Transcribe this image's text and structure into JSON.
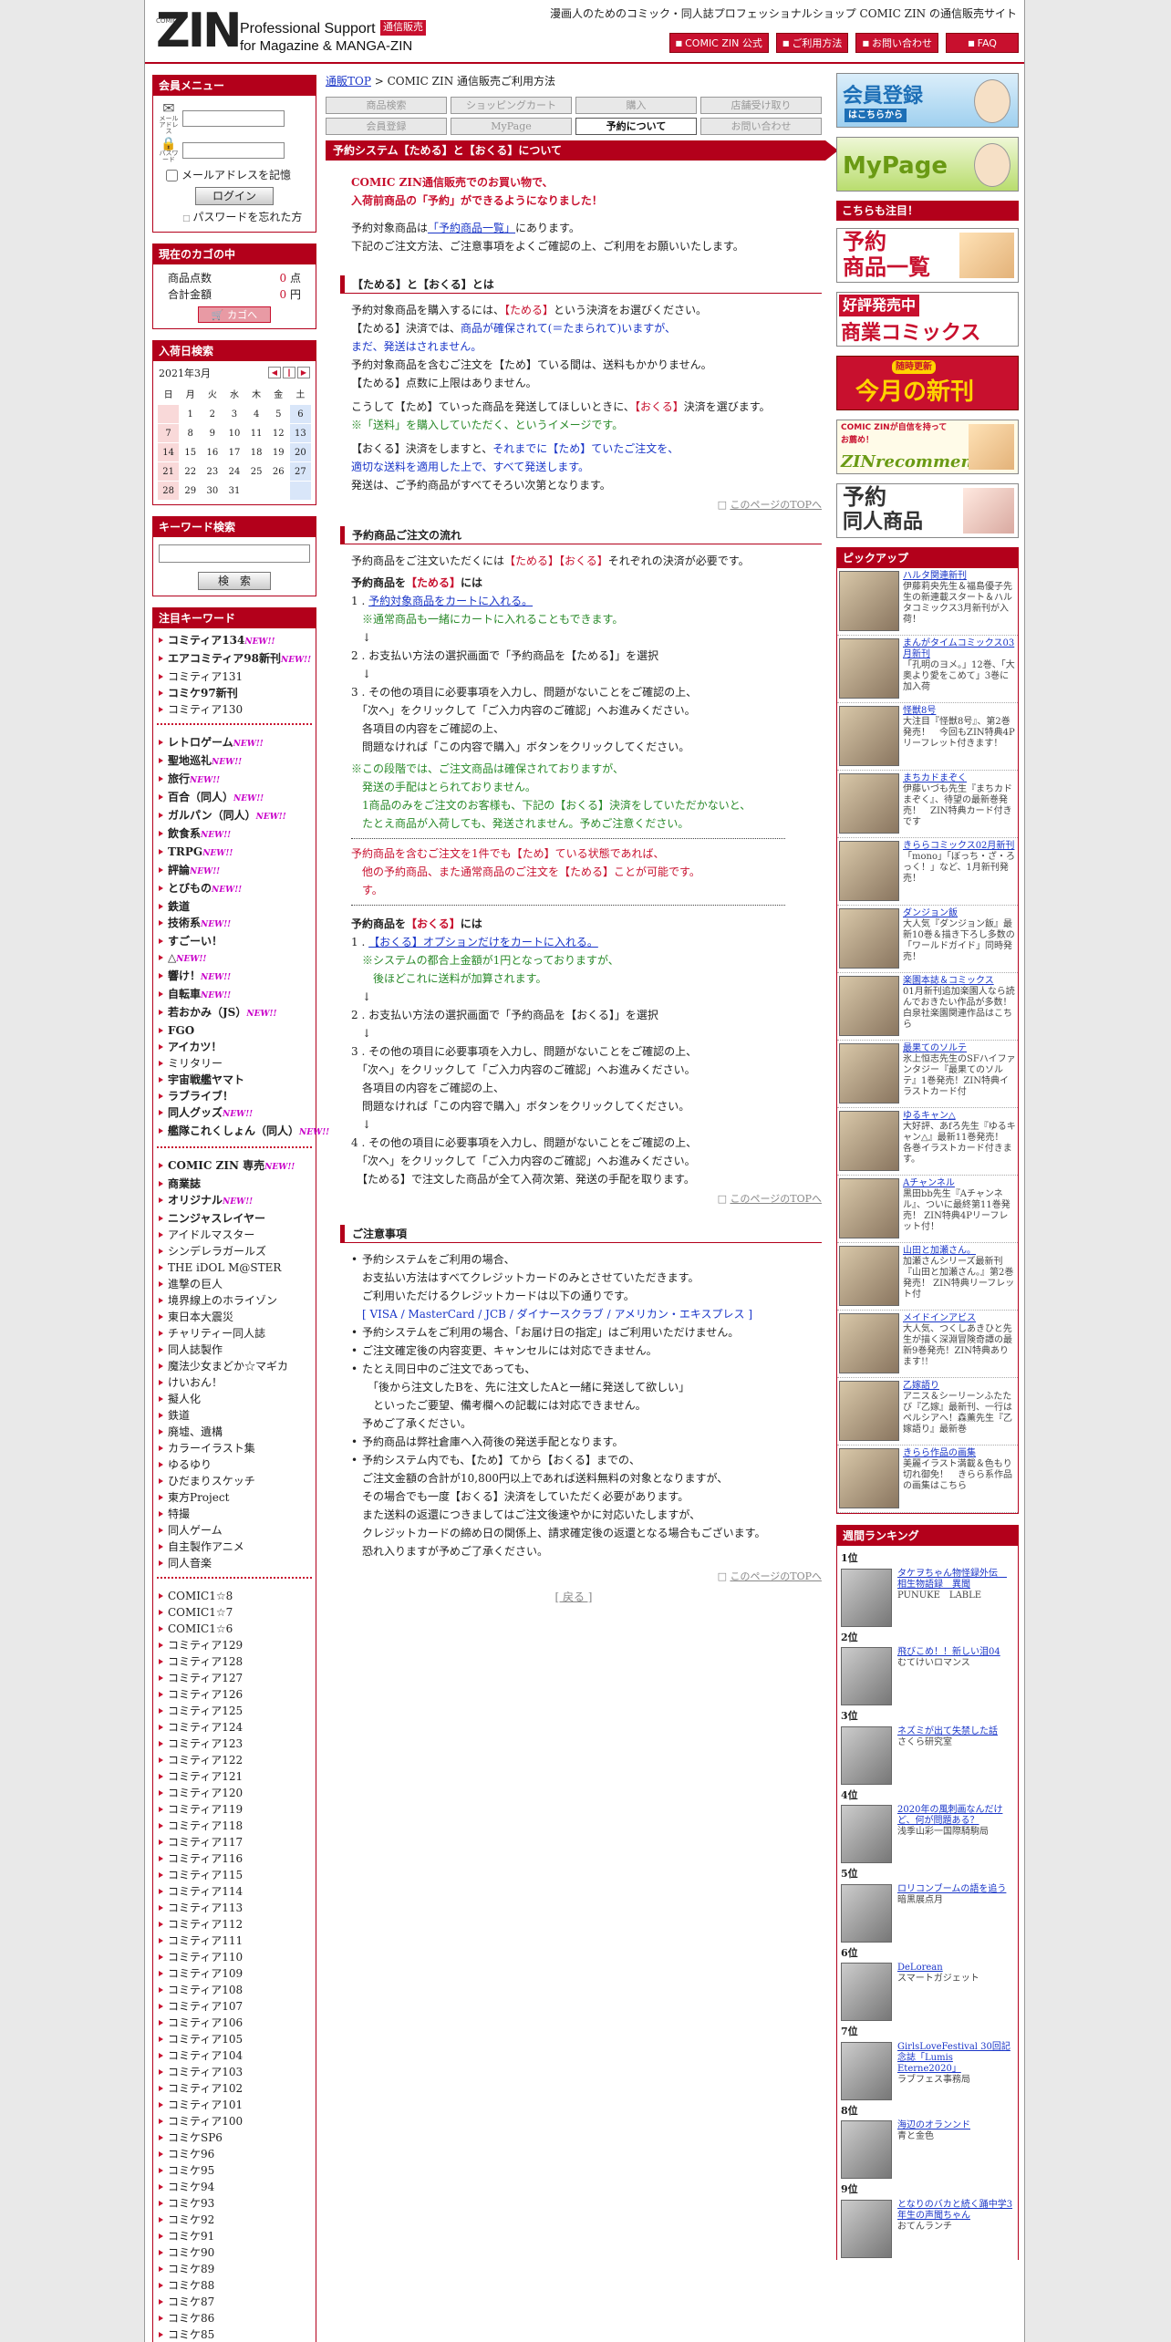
{
  "header": {
    "logo_small": "COMIC",
    "logo": "ZIN",
    "line1": "Professional Support",
    "badge": "通信販売",
    "line2": "for Magazine & MANGA-ZIN",
    "tagline": "漫画人のためのコミック・同人誌プロフェッショナルショップ COMIC ZIN の通信販売サイト",
    "buttons": [
      "COMIC ZIN 公式",
      "ご利用方法",
      "お問い合わせ",
      "FAQ"
    ]
  },
  "login": {
    "title": "会員メニュー",
    "mail_label": "メールアドレス",
    "pass_label": "パスワード",
    "remember": "メールアドレスを記憶",
    "login_button": "ログイン",
    "forgot": "パスワードを忘れた方"
  },
  "cart": {
    "title": "現在のカゴの中",
    "count_label": "商品点数",
    "count_value": "0",
    "count_unit": "点",
    "total_label": "合計金額",
    "total_value": "0",
    "total_unit": "円",
    "button": "カゴへ"
  },
  "calendar": {
    "title": "入荷日検索",
    "month": "2021年3月",
    "weekdays": [
      "日",
      "月",
      "火",
      "水",
      "木",
      "金",
      "土"
    ],
    "weeks": [
      [
        "",
        "1",
        "2",
        "3",
        "4",
        "5",
        "6"
      ],
      [
        "7",
        "8",
        "9",
        "10",
        "11",
        "12",
        "13"
      ],
      [
        "14",
        "15",
        "16",
        "17",
        "18",
        "19",
        "20"
      ],
      [
        "21",
        "22",
        "23",
        "24",
        "25",
        "26",
        "27"
      ],
      [
        "28",
        "29",
        "30",
        "31",
        "",
        "",
        ""
      ]
    ]
  },
  "search": {
    "title": "キーワード検索",
    "button": "検　索"
  },
  "keywords": {
    "title": "注目キーワード",
    "new_label": "NEW!!",
    "group1": [
      {
        "t": "コミティア134",
        "b": true,
        "n": true
      },
      {
        "t": "エアコミティア98新刊",
        "b": true,
        "n": true
      },
      {
        "t": "コミティア131",
        "b": false,
        "n": false
      },
      {
        "t": "コミケ97新刊",
        "b": true,
        "n": false
      },
      {
        "t": "コミティア130",
        "b": false,
        "n": false
      }
    ],
    "group2": [
      {
        "t": "レトロゲーム",
        "b": true,
        "n": true
      },
      {
        "t": "聖地巡礼",
        "b": true,
        "n": true
      },
      {
        "t": "旅行",
        "b": true,
        "n": true
      },
      {
        "t": "百合（同人）",
        "b": true,
        "n": true
      },
      {
        "t": "ガルパン（同人）",
        "b": true,
        "n": true
      },
      {
        "t": "飲食系",
        "b": true,
        "n": true
      },
      {
        "t": "TRPG",
        "b": true,
        "n": true
      },
      {
        "t": "評論",
        "b": true,
        "n": true
      },
      {
        "t": "とびもの",
        "b": true,
        "n": true
      },
      {
        "t": "鉄道",
        "b": true,
        "n": false
      },
      {
        "t": "技術系",
        "b": true,
        "n": true
      },
      {
        "t": "すごーい！",
        "b": true,
        "n": false
      },
      {
        "t": "△",
        "b": true,
        "n": true
      },
      {
        "t": "響け！",
        "b": true,
        "n": true
      },
      {
        "t": "自転車",
        "b": true,
        "n": true
      },
      {
        "t": "若おかみ（JS）",
        "b": true,
        "n": true
      },
      {
        "t": "FGO",
        "b": true,
        "n": false
      },
      {
        "t": "アイカツ！",
        "b": true,
        "n": false
      },
      {
        "t": "ミリタリー",
        "b": false,
        "n": false
      },
      {
        "t": "宇宙戦艦ヤマト",
        "b": true,
        "n": false
      },
      {
        "t": "ラブライブ！",
        "b": true,
        "n": false
      },
      {
        "t": "同人グッズ",
        "b": true,
        "n": true
      },
      {
        "t": "艦隊これくしょん（同人）",
        "b": true,
        "n": true
      }
    ],
    "group3": [
      {
        "t": "COMIC ZIN 専売",
        "b": true,
        "n": true
      },
      {
        "t": "商業誌",
        "b": true,
        "n": false
      },
      {
        "t": "オリジナル",
        "b": true,
        "n": true
      },
      {
        "t": "ニンジャスレイヤー",
        "b": true,
        "n": false
      },
      {
        "t": "アイドルマスター",
        "b": false,
        "n": false
      },
      {
        "t": "シンデレラガールズ",
        "b": false,
        "n": false
      },
      {
        "t": "THE iDOL M@STER",
        "b": false,
        "n": false
      },
      {
        "t": "進撃の巨人",
        "b": false,
        "n": false
      },
      {
        "t": "境界線上のホライゾン",
        "b": false,
        "n": false
      },
      {
        "t": "東日本大震災",
        "b": false,
        "n": false
      },
      {
        "t": "チャリティー同人誌",
        "b": false,
        "n": false
      },
      {
        "t": "同人誌製作",
        "b": false,
        "n": false
      },
      {
        "t": "魔法少女まどか☆マギカ",
        "b": false,
        "n": false
      },
      {
        "t": "けいおん！",
        "b": false,
        "n": false
      },
      {
        "t": "擬人化",
        "b": false,
        "n": false
      },
      {
        "t": "鉄道",
        "b": false,
        "n": false
      },
      {
        "t": "廃墟、遺構",
        "b": false,
        "n": false
      },
      {
        "t": "カラーイラスト集",
        "b": false,
        "n": false
      },
      {
        "t": "ゆるゆり",
        "b": false,
        "n": false
      },
      {
        "t": "ひだまりスケッチ",
        "b": false,
        "n": false
      },
      {
        "t": "東方Project",
        "b": false,
        "n": false
      },
      {
        "t": "特撮",
        "b": false,
        "n": false
      },
      {
        "t": "同人ゲーム",
        "b": false,
        "n": false
      },
      {
        "t": "自主製作アニメ",
        "b": false,
        "n": false
      },
      {
        "t": "同人音楽",
        "b": false,
        "n": false
      }
    ],
    "group4": [
      "COMIC1☆8",
      "COMIC1☆7",
      "COMIC1☆6",
      "コミティア129",
      "コミティア128",
      "コミティア127",
      "コミティア126",
      "コミティア125",
      "コミティア124",
      "コミティア123",
      "コミティア122",
      "コミティア121",
      "コミティア120",
      "コミティア119",
      "コミティア118",
      "コミティア117",
      "コミティア116",
      "コミティア115",
      "コミティア114",
      "コミティア113",
      "コミティア112",
      "コミティア111",
      "コミティア110",
      "コミティア109",
      "コミティア108",
      "コミティア107",
      "コミティア106",
      "コミティア105",
      "コミティア104",
      "コミティア103",
      "コミティア102",
      "コミティア101",
      "コミティア100",
      "コミケSP6",
      "コミケ96",
      "コミケ95",
      "コミケ94",
      "コミケ93",
      "コミケ92",
      "コミケ91",
      "コミケ90",
      "コミケ89",
      "コミケ88",
      "コミケ87",
      "コミケ86",
      "コミケ85"
    ]
  },
  "main": {
    "crumb_link": "通販TOP",
    "crumb_rest": " > COMIC ZIN 通信販売ご利用方法",
    "tabs": [
      "商品検索",
      "ショッピングカート",
      "購入",
      "店舗受け取り",
      "会員登録",
      "MyPage",
      "予約について",
      "お問い合わせ"
    ],
    "title": "予約システム【ためる】と【おくる】について",
    "intro_red1": "COMIC ZIN通信販売でのお買い物で、",
    "intro_red2": "入荷前商品の「予約」ができるようになりました！",
    "intro1a": "予約対象商品は",
    "intro1link": "「予約商品一覧」",
    "intro1b": "にあります。",
    "intro2": "下記のご注文方法、ご注意事項をよくご確認の上、ご利用をお願いいたします。",
    "s1_title": "【ためる】と【おくる】とは",
    "s1_p1a": "予約対象商品を購入するには、",
    "s1_p1r": "【ためる】",
    "s1_p1b": "という決済をお選びください。",
    "s1_p2a": "【ためる】決済では、",
    "s1_p2b": "商品が確保されて(＝たまられて)いますが、",
    "s1_p2c": "まだ、発送はされません。",
    "s1_p3": "予約対象商品を含むご注文を【ため】ている間は、送料もかかりません。",
    "s1_p4": "【ためる】点数に上限はありません。",
    "s1_p5a": "こうして【ため】ていった商品を発送してほしいときに、",
    "s1_p5r": "【おくる】",
    "s1_p5b": "決済を選びます。",
    "s1_p6": "※「送料」を購入していただく、というイメージです。",
    "s1_p7a": "【おくる】決済をしますと、",
    "s1_p7b": "それまでに【ため】ていたご注文を、",
    "s1_p7c": "適切な送料を適用した上で、すべて発送します。",
    "s1_p8": "発送は、ご予約商品がすべてそろい次第となります。",
    "to_top": "このページのTOPへ",
    "s2_title": "予約商品ご注文の流れ",
    "s2_p1a": "予約商品をご注文いただくには",
    "s2_p1r": "【ためる】【おくる】",
    "s2_p1b": "それぞれの決済が必要です。",
    "s2_h1a": "予約商品を",
    "s2_h1r": "【ためる】",
    "s2_h1b": "には",
    "s2_a1": "予約対象商品をカートに入れる。",
    "s2_a1n": "※通常商品も一緒にカートに入れることもできます。",
    "s2_a2": "お支払い方法の選択画面で「予約商品を【ためる】」を選択",
    "s2_a3a": "その他の項目に必要事項を入力し、問題がないことをご確認の上、",
    "s2_a3b": "「次へ」をクリックして「ご入力内容のご確認」へお進みください。",
    "s2_a3c": "各項目の内容をご確認の上、",
    "s2_a3d": "問題なければ「この内容で購入」ボタンをクリックしてください。",
    "s2_n1": "※この段階では、ご注文商品は確保されておりますが、",
    "s2_n2": "発送の手配はとられておりません。",
    "s2_n3": "1商品のみをご注文のお客様も、下記の【おくる】決済をしていただかないと、",
    "s2_n4": "たとえ商品が入荷しても、発送されません。予めご注意ください。",
    "s2_w1": "予約商品を含むご注文を1件でも【ため】ている状態であれば、",
    "s2_w2": "他の予約商品、また通常商品のご注文を【ためる】ことが可能です。",
    "s2_h2a": "予約商品を",
    "s2_h2r": "【おくる】",
    "s2_h2b": "には",
    "s2_b1": "【おくる】オプションだけをカートに入れる。",
    "s2_b1n1": "※システムの都合上金額が1円となっておりますが、",
    "s2_b1n2": "後ほどこれに送料が加算されます。",
    "s2_b2": "お支払い方法の選択画面で「予約商品を【おくる】」を選択",
    "s2_b4e": "【ためる】で注文した商品が全て入荷次第、発送の手配を取ります。",
    "s3_title": "ご注意事項",
    "s3_1a": "予約システムをご利用の場合、",
    "s3_1b": "お支払い方法はすべてクレジットカードのみとさせていただきます。",
    "s3_1c": "ご利用いただけるクレジットカードは以下の通りです。",
    "s3_1d": "[ VISA / MasterCard / JCB / ダイナースクラブ / アメリカン・エキスプレス ]",
    "s3_2": "予約システムをご利用の場合、「お届け日の指定」はご利用いただけません。",
    "s3_3": "ご注文確定後の内容変更、キャンセルには対応できません。",
    "s3_4a": "たとえ同日中のご注文であっても、",
    "s3_4b": "「後から注文したBを、先に注文したAと一緒に発送して欲しい」",
    "s3_4c": "といったご要望、備考欄への記載には対応できません。",
    "s3_4d": "予めご了承ください。",
    "s3_5": "予約商品は弊社倉庫へ入荷後の発送手配となります。",
    "s3_6a": "予約システム内でも、【ため】てから【おくる】までの、",
    "s3_6b": "ご注文金額の合計が10,800円以上であれば送料無料の対象となりますが、",
    "s3_6c": "その場合でも一度【おくる】決済をしていただく必要があります。",
    "s3_6d": "また送料の返還につきましてはご注文後速やかに対応いたしますが、",
    "s3_6e": "クレジットカードの締め日の関係上、請求確定後の返還となる場合もございます。",
    "s3_6f": "恐れ入りますが予めご了承ください。",
    "back": "[ 戻る ]"
  },
  "right": {
    "banners": [
      {
        "t1": "会員登録",
        "t2": "はこちらから"
      },
      {
        "t1": "MyPage",
        "t2": ""
      }
    ],
    "attention_title": "こちらも注目！",
    "promo": [
      {
        "t1": "予約",
        "t2": "商品一覧"
      },
      {
        "t1": "好評発売中",
        "t2": "商業コミックス"
      },
      {
        "t1": "随時更新",
        "t2": "今月の新刊"
      },
      {
        "t1": "COMIC ZINが自信を持ってお薦め！",
        "t2": "ZINrecommend"
      },
      {
        "t1": "予約",
        "t2": "同人商品"
      }
    ],
    "pickup_title": "ピックアップ",
    "pickup": [
      {
        "t": "ハルタ関連新刊",
        "d": "伊藤莉央先生＆福島優子先生の新連載スタート＆ハルタコミックス3月新刊が入荷！"
      },
      {
        "t": "まんがタイムコミックス03月新刊",
        "d": "「孔明のヨメ。」12巻、「大奥より愛をこめて」3巻に加入荷"
      },
      {
        "t": "怪獣8号",
        "d": "大注目『怪獣8号』、第2巻発売！　今回もZIN特典4Pリーフレット付きます！"
      },
      {
        "t": "まちカドまぞく",
        "d": "伊藤いづも先生『まちカドまぞく』、待望の最新巻発売！　ZIN特典カード付きです"
      },
      {
        "t": "きららコミックス02月新刊",
        "d": "「mono」「ぼっち・ざ・ろっく！」など、1月新刊発売！"
      },
      {
        "t": "ダンジョン飯",
        "d": "大人気『ダンジョン飯』最新10巻＆描き下ろし多数の「ワールドガイド」同時発売！"
      },
      {
        "t": "楽園本誌＆コミックス",
        "d": "01月新刊追加楽園人なら読んでおきたい作品が多数！白泉社楽園関連作品はこちら"
      },
      {
        "t": "最果てのソルテ",
        "d": "氷上恒志先生のSFハイファンタジー『最果てのソルテ』1巻発売！ZIN特典イラストカード付"
      },
      {
        "t": "ゆるキャン△",
        "d": "大好評、あfろ先生『ゆるキャン△』最新11巻発売！　各巻イラストカード付きます。"
      },
      {
        "t": "Aチャンネル",
        "d": "黒田bb先生『Aチャンネル』、ついに最終第11巻発売！ ZIN特典4Pリーフレット付！"
      },
      {
        "t": "山田と加瀬さん。",
        "d": "加瀬さんシリーズ最新刊『山田と加瀬さん。』第2巻発売！ ZIN特典リーフレット付"
      },
      {
        "t": "メイドインアビス",
        "d": "大人気、つくしあきひと先生が描く深淵冒険奇譚の最新9巻発売！ZIN特典あります!!"
      },
      {
        "t": "乙嫁語り",
        "d": "アニス＆シーリーンふたたび『乙嫁』最新刊、一行はペルシアへ！森薫先生『乙嫁語り』最新巻"
      },
      {
        "t": "きらら作品の画集",
        "d": "美麗イラスト満載＆色もり切れ御免！　きらら系作品の画集はこちら"
      }
    ],
    "ranking_title": "週間ランキング",
    "ranking": [
      {
        "r": "1位",
        "t": "タケヲちゃん物怪録外伝　相生物語録　異聞",
        "a": "PUNUKE　LABLE"
      },
      {
        "r": "2位",
        "t": "飛びこめ！！新しい泪04",
        "a": "むてけいロマンス"
      },
      {
        "r": "3位",
        "t": "ネズミが出て失禁した話",
        "a": "さくら研究室"
      },
      {
        "r": "4位",
        "t": "2020年の風刺画なんだけど、何が問題ある？",
        "a": "浅季山彩一国際騎駒局"
      },
      {
        "r": "5位",
        "t": "ロリコンブームの語を追う",
        "a": "暗黒展点月"
      },
      {
        "r": "6位",
        "t": "DeLorean",
        "a": "スマートガジェット"
      },
      {
        "r": "7位",
        "t": "GirlsLoveFestival 30回記念誌「Lumis Eterne2020」",
        "a": "ラブフェス事務局"
      },
      {
        "r": "8位",
        "t": "海辺のオランンド",
        "a": "青と金色"
      },
      {
        "r": "9位",
        "t": "となりのバカと続く踊中学3年生の声聞ちゃん",
        "a": "おてんランチ"
      }
    ]
  }
}
